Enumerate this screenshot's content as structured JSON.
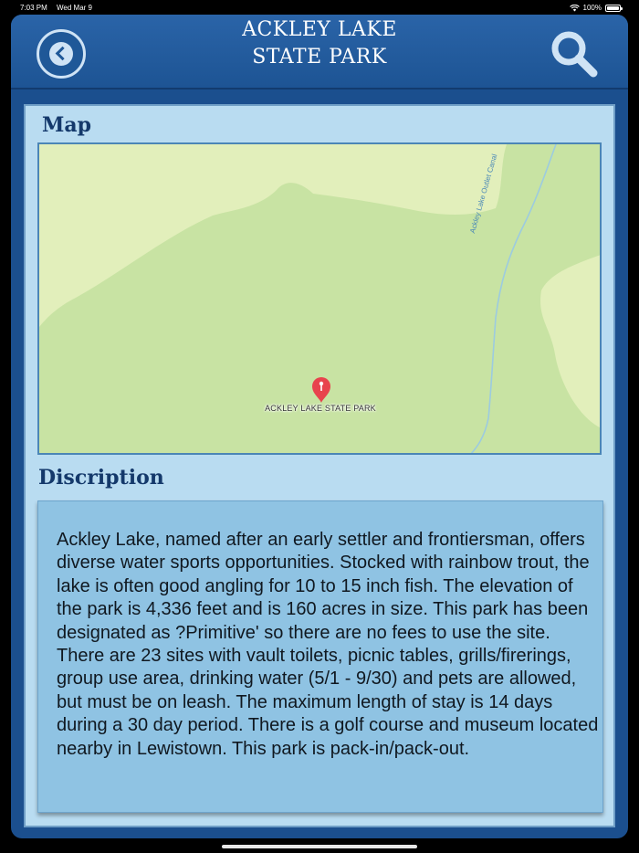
{
  "status_bar": {
    "time": "7:03 PM",
    "date": "Wed Mar 9",
    "battery": "100%"
  },
  "header": {
    "title_line1": "ACKLEY LAKE",
    "title_line2": "STATE PARK",
    "back_icon": "chevron-left-circle-icon",
    "search_icon": "search-icon"
  },
  "map_section": {
    "label": "Map",
    "pin_label": "ACKLEY LAKE STATE PARK",
    "canal_label": "Ackley Lake Outlet Canal"
  },
  "description_section": {
    "label": "Discription",
    "text": "Ackley Lake, named after an early settler and frontiersman, offers diverse water sports opportunities. Stocked with rainbow trout, the lake is often good angling for 10 to 15 inch fish. The elevation of the park is 4,336 feet and is 160 acres in size. This park has been designated as ?Primitive' so there are no fees to use the site. There are 23 sites with vault toilets, picnic tables, grills/firerings, group use area, drinking water (5/1 - 9/30) and pets are allowed, but must be on leash. The maximum length of stay is 14 days during a 30 day period. There is a golf course and museum located nearby in Lewistown. This park is pack-in/pack-out."
  },
  "colors": {
    "header_bg": "#1f5898",
    "panel_bg": "#b9dcf1",
    "desc_bg": "#8fc3e3",
    "section_label": "#14396b",
    "map_green": "#c8e3a3",
    "map_light": "#e2efbb",
    "pin_red": "#e8434d"
  }
}
